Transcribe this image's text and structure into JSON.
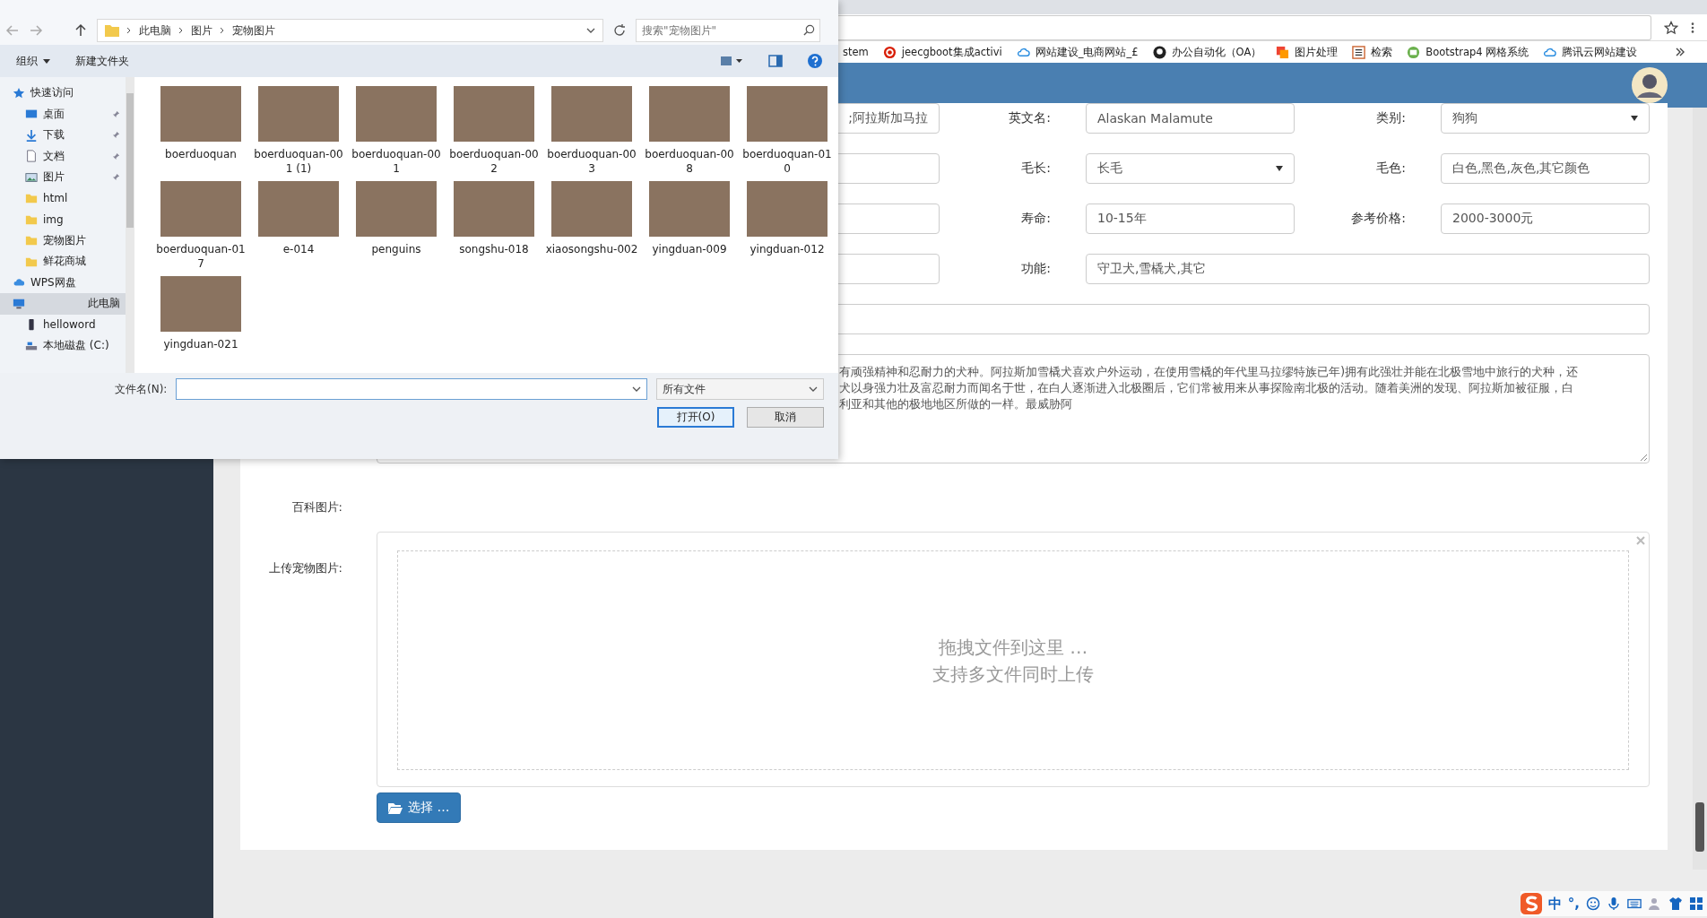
{
  "browser": {
    "bookmarks": [
      {
        "label": "stem",
        "kind": "none"
      },
      {
        "label": "jeecgboot集成activi",
        "kind": "red-circle"
      },
      {
        "label": "网站建设_电商网站_£",
        "kind": "cloud"
      },
      {
        "label": "办公自动化（OA）",
        "kind": "cat-circle"
      },
      {
        "label": "图片处理",
        "kind": "stack"
      },
      {
        "label": "检索",
        "kind": "square"
      },
      {
        "label": "Bootstrap4 网格系统",
        "kind": "green-circle"
      },
      {
        "label": "腾讯云网站建设",
        "kind": "cloud"
      }
    ]
  },
  "form": {
    "rows": [
      {
        "cells": [
          {
            "kind": "partial-input",
            "value": ";阿拉斯加马拉"
          },
          {
            "kind": "label",
            "text": "英文名:"
          },
          {
            "kind": "input",
            "value": "Alaskan Malamute"
          },
          {
            "kind": "label",
            "text": "类别:"
          },
          {
            "kind": "select",
            "value": "狗狗"
          }
        ]
      },
      {
        "cells": [
          {
            "kind": "input"
          },
          {
            "kind": "label",
            "text": "毛长:"
          },
          {
            "kind": "select",
            "value": "长毛"
          },
          {
            "kind": "label",
            "text": "毛色:"
          },
          {
            "kind": "input",
            "value": "白色,黑色,灰色,其它颜色"
          }
        ]
      },
      {
        "cells": [
          {
            "kind": "input"
          },
          {
            "kind": "label",
            "text": "寿命:"
          },
          {
            "kind": "input",
            "value": "10-15年"
          },
          {
            "kind": "label",
            "text": "参考价格:"
          },
          {
            "kind": "input",
            "value": "2000-3000元"
          }
        ]
      },
      {
        "cells": [
          {
            "kind": "input"
          },
          {
            "kind": "label",
            "text": "功能:"
          },
          {
            "kind": "wide-input",
            "value": "守卫犬,雪橇犬,其它"
          }
        ]
      },
      {
        "cells": [
          {
            "kind": "full-input"
          }
        ]
      },
      {
        "cells": [
          {
            "kind": "textarea",
            "lines": [
              "有顽强精神和忍耐力的犬种。阿拉斯加雪橇犬喜欢户外运动，在使用雪橇的年代里马拉缪特族已年)拥有此强壮并能在北极雪地中旅行的犬种，还",
              "犬以身强力壮及富忍耐力而闻名于世，在白人逐渐进入北极圈后，它们常被用来从事探险南北极的活动。随着美洲的发现、阿拉斯加被征服，白",
              "利亚和其他的极地地区所做的一样。最威胁阿"
            ]
          }
        ]
      }
    ],
    "encyclopedia_label": "百科图片:",
    "upload_label": "上传宠物图片:",
    "upload_hint": [
      "拖拽文件到这里 …",
      "支持多文件同时上传"
    ],
    "choose_button": "选择 …"
  },
  "file_dialog": {
    "path": [
      "此电脑",
      "图片",
      "宠物图片"
    ],
    "search_placeholder": "搜索\"宠物图片\"",
    "organize": "组织",
    "new_folder": "新建文件夹",
    "nav": [
      {
        "label": "快速访问",
        "kind": "star",
        "pinned": false,
        "selected": false,
        "children": [
          {
            "label": "桌面",
            "kind": "desktop",
            "pinned": true,
            "selected": false
          },
          {
            "label": "下载",
            "kind": "download",
            "pinned": true,
            "selected": false
          },
          {
            "label": "文档",
            "kind": "document",
            "pinned": true,
            "selected": false
          },
          {
            "label": "图片",
            "kind": "picture",
            "pinned": true,
            "selected": false
          },
          {
            "label": "html",
            "kind": "folder",
            "pinned": false,
            "selected": false
          },
          {
            "label": "img",
            "kind": "folder",
            "pinned": false,
            "selected": false
          },
          {
            "label": "宠物图片",
            "kind": "folder",
            "pinned": false,
            "selected": false
          },
          {
            "label": "鲜花商城",
            "kind": "folder",
            "pinned": false,
            "selected": false
          }
        ]
      },
      {
        "label": "WPS网盘",
        "kind": "cloud",
        "pinned": false,
        "selected": false
      },
      {
        "label": "此电脑",
        "kind": "pc",
        "pinned": false,
        "selected": true,
        "children": [
          {
            "label": "helloword",
            "kind": "phone",
            "pinned": false,
            "selected": false
          },
          {
            "label": "本地磁盘 (C:)",
            "kind": "drive",
            "pinned": false,
            "selected": false
          }
        ]
      }
    ],
    "files": [
      {
        "name": "boerduoquan"
      },
      {
        "name": "boerduoquan-001 (1)"
      },
      {
        "name": "boerduoquan-001"
      },
      {
        "name": "boerduoquan-002"
      },
      {
        "name": "boerduoquan-003"
      },
      {
        "name": "boerduoquan-008"
      },
      {
        "name": "boerduoquan-010"
      },
      {
        "name": "boerduoquan-017"
      },
      {
        "name": "e-014"
      },
      {
        "name": "penguins"
      },
      {
        "name": "songshu-018"
      },
      {
        "name": "xiaosongshu-002"
      },
      {
        "name": "yingduan-009"
      },
      {
        "name": "yingduan-012"
      },
      {
        "name": "yingduan-021"
      }
    ],
    "filename_label": "文件名(N):",
    "filter": "所有文件",
    "open_button": "打开(O)",
    "cancel_button": "取消"
  },
  "ime_toolbar": {
    "mode": "中",
    "punctuation": "°,"
  }
}
